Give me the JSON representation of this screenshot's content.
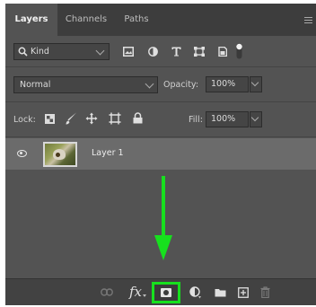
{
  "tabs": [
    {
      "label": "Layers",
      "active": true
    },
    {
      "label": "Channels",
      "active": false
    },
    {
      "label": "Paths",
      "active": false
    }
  ],
  "filter": {
    "kind_label": "Kind",
    "icons": [
      "image-filter-icon",
      "adjustment-filter-icon",
      "type-filter-icon",
      "shape-filter-icon",
      "smart-object-filter-icon",
      "filter-toggle-icon"
    ]
  },
  "blend": {
    "mode": "Normal",
    "opacity_label": "Opacity:",
    "opacity_value": "100%"
  },
  "lock": {
    "label": "Lock:",
    "icons": [
      "lock-transparent-icon",
      "lock-image-icon",
      "lock-position-icon",
      "lock-artboard-icon",
      "lock-all-icon"
    ],
    "fill_label": "Fill:",
    "fill_value": "100%"
  },
  "layers": [
    {
      "name": "Layer 1",
      "visible": true
    }
  ],
  "bottom_icons": [
    "link-layers-icon",
    "fx-icon",
    "add-mask-icon",
    "adjustment-layer-icon",
    "group-folder-icon",
    "new-layer-icon",
    "trash-icon"
  ],
  "fx_label": "fx",
  "colors": {
    "highlight": "#17e01e",
    "panel": "#535353",
    "tabbar": "#3d3d3d"
  }
}
